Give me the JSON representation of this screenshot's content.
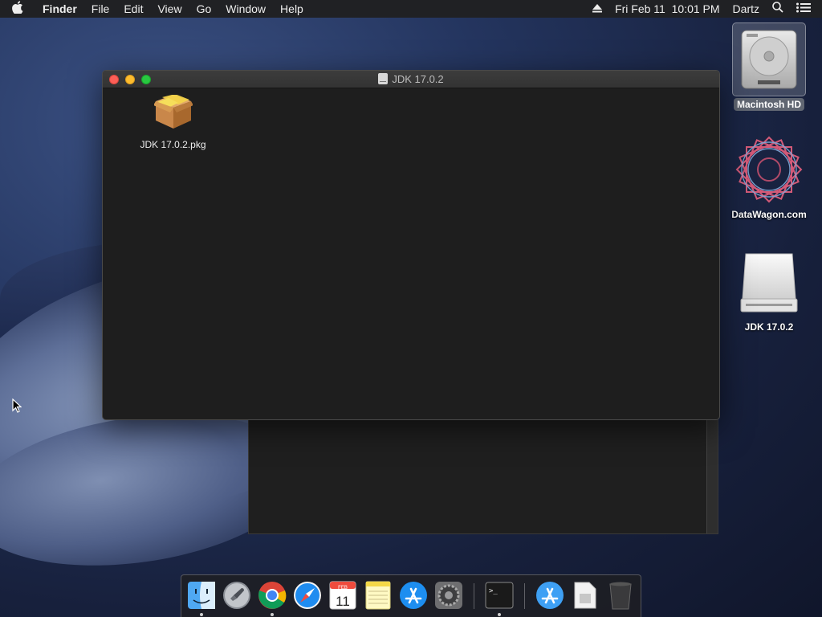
{
  "menubar": {
    "app_name": "Finder",
    "items": [
      "File",
      "Edit",
      "View",
      "Go",
      "Window",
      "Help"
    ],
    "datetime": "Fri Feb 11  10:01 PM",
    "user": "Dartz"
  },
  "desktop_icons": [
    {
      "label": "Macintosh HD",
      "icon": "hard-drive-icon",
      "selected": true
    },
    {
      "label": "DataWagon.com",
      "icon": "datawagon-logo-icon",
      "selected": false
    },
    {
      "label": "JDK 17.0.2",
      "icon": "mounted-disk-image-icon",
      "selected": false
    }
  ],
  "finder_window": {
    "title": "JDK 17.0.2",
    "items": [
      {
        "label": "JDK 17.0.2.pkg",
        "icon": "package-installer-icon"
      }
    ]
  },
  "calendar": {
    "month": "FEB",
    "day": "11"
  },
  "dock": {
    "apps": [
      "Finder",
      "Launchpad",
      "Chrome",
      "Safari",
      "Calendar",
      "Notes",
      "App Store",
      "System Preferences",
      "Terminal",
      "Applications",
      "Downloads",
      "Trash"
    ]
  },
  "colors": {
    "close": "#fc5f57",
    "minimize": "#fdbc2e",
    "zoom": "#28c840",
    "menubar": "#202124"
  }
}
